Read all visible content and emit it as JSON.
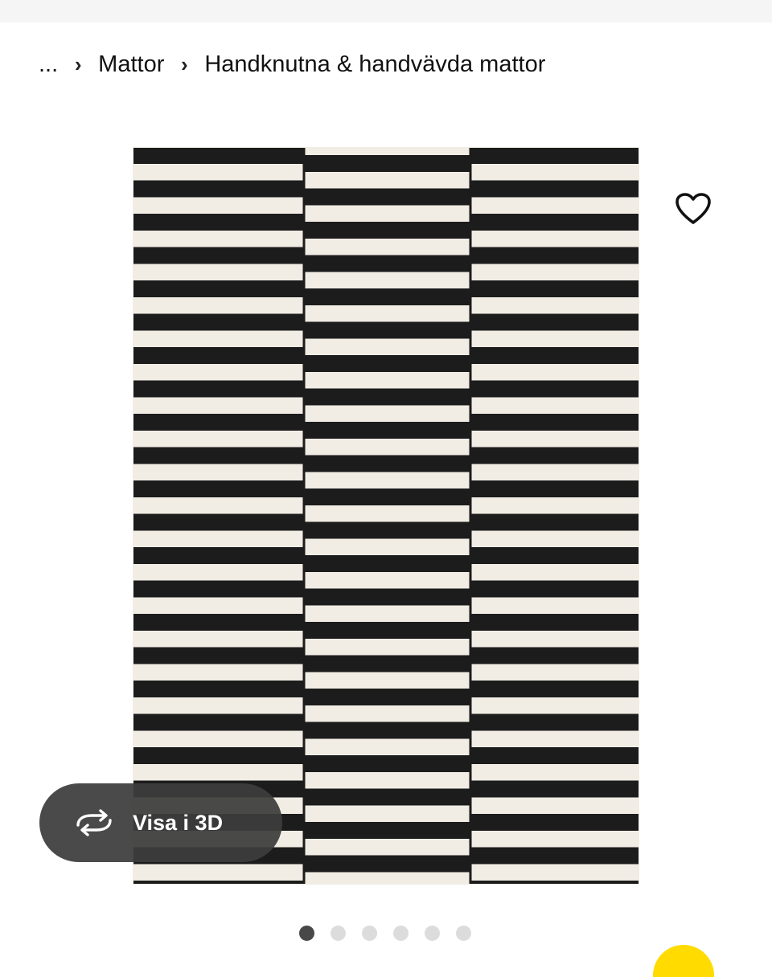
{
  "breadcrumb": {
    "ellipsis": "...",
    "separator": "›",
    "items": [
      "Mattor",
      "Handknutna & handvävda mattor"
    ]
  },
  "product_image": {
    "alt": "Randig svart och vit matta",
    "colors": {
      "dark": "#1c1c1c",
      "light": "#f1ede5"
    }
  },
  "favorite": {
    "icon": "heart-icon"
  },
  "view_3d": {
    "label": "Visa i 3D",
    "icon": "rotate-3d-icon"
  },
  "carousel": {
    "total": 6,
    "active": 0
  },
  "accent_color": "#ffdb00"
}
